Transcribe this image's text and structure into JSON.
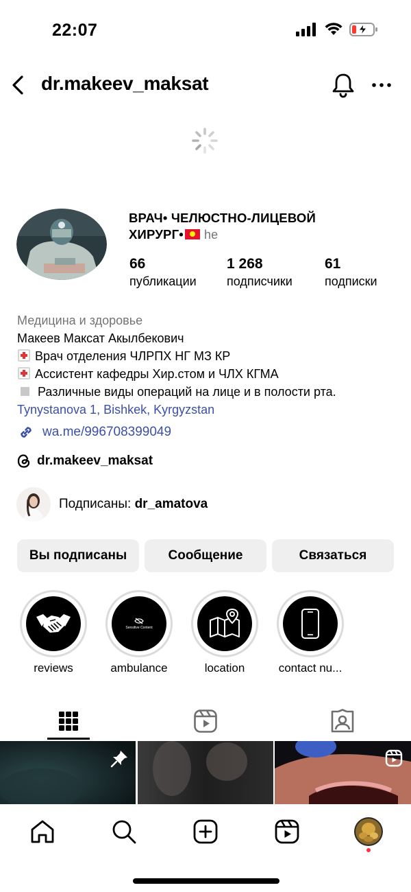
{
  "status_bar": {
    "time": "22:07"
  },
  "header": {
    "username": "dr.makeev_maksat"
  },
  "profile": {
    "full_name": "ВРАЧ• ЧЕЛЮСТНО-ЛИЦЕВОЙ ХИРУРГ•",
    "pronouns": "he",
    "stats": [
      {
        "value": "66",
        "label": "публикации"
      },
      {
        "value": "1 268",
        "label": "подписчики"
      },
      {
        "value": "61",
        "label": "подписки"
      }
    ],
    "category": "Медицина и здоровье",
    "bio_name": "Макеев Максат Акылбекович",
    "bio_line1": "Врач отделения ЧЛРПХ НГ МЗ КР",
    "bio_line2": "Ассистент кафедры Хир.стом и ЧЛХ КГМА",
    "bio_line3": "Различные виды операций на лице и в полости рта.",
    "address": "Tynystanova 1, Bishkek, Kyrgyzstan",
    "link": "wa.me/996708399049",
    "threads_handle": "dr.makeev_maksat",
    "followed_by_prefix": "Подписаны: ",
    "followed_by_user": "dr_amatova"
  },
  "buttons": {
    "following": "Вы подписаны",
    "message": "Сообщение",
    "contact": "Связаться"
  },
  "highlights": [
    {
      "label": "reviews",
      "icon": "handshake-icon"
    },
    {
      "label": "ambulance",
      "icon": "sensitive-content-icon",
      "inner_text": "Sensitive Content"
    },
    {
      "label": "location",
      "icon": "map-icon"
    },
    {
      "label": "contact nu...",
      "icon": "phone-icon"
    }
  ],
  "tabs": [
    "grid-icon",
    "reels-icon",
    "tagged-icon"
  ],
  "nav": [
    "home-icon",
    "search-icon",
    "create-icon",
    "reels-icon",
    "profile-avatar"
  ],
  "colors": {
    "link": "#3b4fa8",
    "secondary_text": "#737373",
    "button_bg": "#efefef",
    "notification_dot": "#ff3040"
  }
}
